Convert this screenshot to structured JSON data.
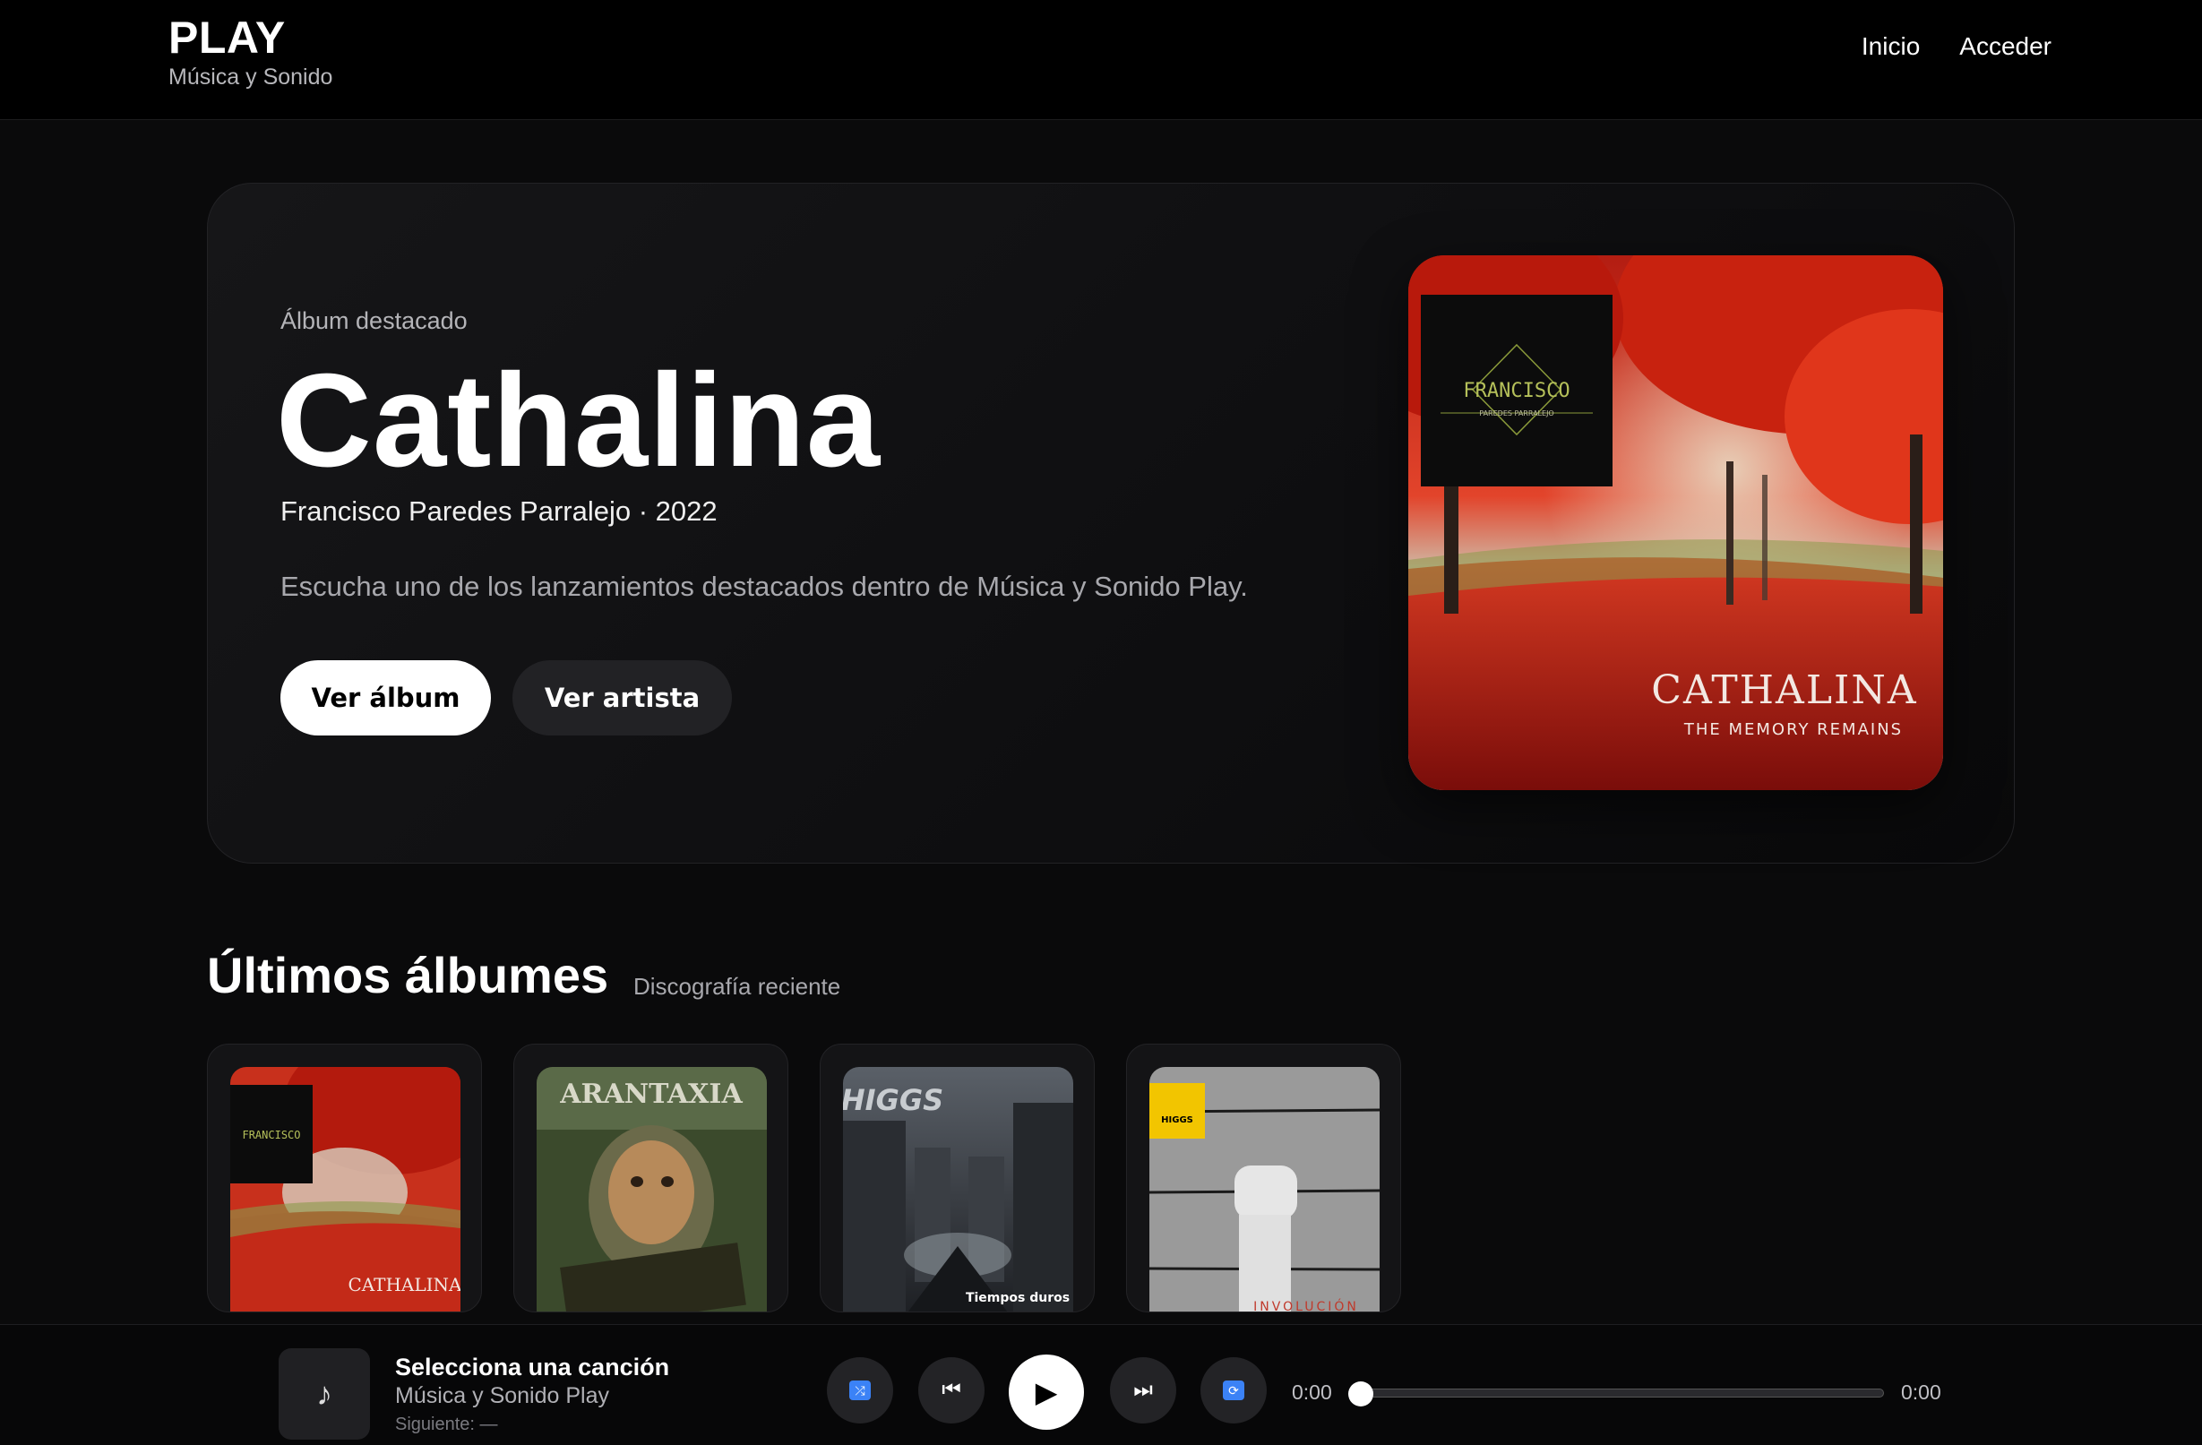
{
  "header": {
    "brand_title": "PLAY",
    "brand_subtitle": "Música y Sonido",
    "nav": [
      "Inicio",
      "Acceder"
    ]
  },
  "hero": {
    "eyebrow": "Álbum destacado",
    "title": "Cathalina",
    "meta": "Francisco Paredes Parralejo · 2022",
    "description": "Escucha uno de los lanzamientos destacados dentro de Música y Sonido Play.",
    "primary_button": "Ver álbum",
    "secondary_button": "Ver artista",
    "cover": {
      "logo_text": "FRANCISCO",
      "logo_subtext": "PAREDES PARRALEJO",
      "title_text": "CATHALINA",
      "subtitle_text": "THE MEMORY REMAINS"
    }
  },
  "section": {
    "title": "Últimos álbumes",
    "subtitle": "Discografía reciente"
  },
  "albums": [
    {
      "cover_text": "CATHALINA",
      "logo_text": "FRANCISCO"
    },
    {
      "cover_text": "ARANTAXIA"
    },
    {
      "cover_text": "HIGGS",
      "caption": "Tiempos duros"
    },
    {
      "cover_text": "INVOLUCIÓN",
      "badge": "HIGGS"
    }
  ],
  "player": {
    "now_playing_title": "Selecciona una canción",
    "now_playing_artist": "Música y Sonido Play",
    "next": "Siguiente: —",
    "time_current": "0:00",
    "time_total": "0:00",
    "progress": 0,
    "note_icon": "♪"
  },
  "colors": {
    "background": "#0a0a0b",
    "accent_blue": "#3b82f6",
    "autumn_red": "#d42a1a"
  }
}
